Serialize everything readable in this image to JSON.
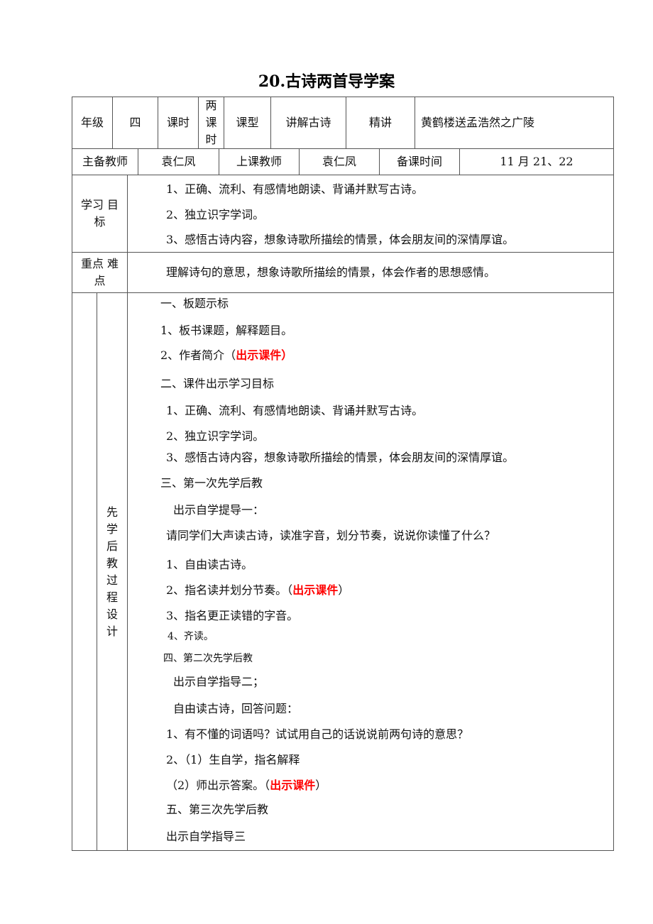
{
  "title": "20.古诗两首导学案",
  "row1": {
    "grade_label": "年级",
    "grade_value": "四",
    "period_label": "课时",
    "period_value_chars": [
      "两",
      "课",
      "时"
    ],
    "type_label": "课型",
    "type_value": "讲解古诗",
    "mode": "精讲",
    "lesson_title": "黄鹤楼送孟浩然之广陵"
  },
  "row2": {
    "main_teacher_label": "主备教师",
    "main_teacher": "袁仁凤",
    "class_teacher_label": "上课教师",
    "class_teacher": "袁仁凤",
    "prep_time_label": "备课时间",
    "prep_time": "11 月 21、22"
  },
  "goals": {
    "label_line1": "学习 目",
    "label_line2": "标",
    "items": [
      "1、正确、流利、有感情地朗读、背诵并默写古诗。",
      "2、独立识字学词。",
      "3、感悟古诗内容，想象诗歌所描绘的情景，体会朋友间的深情厚谊。"
    ]
  },
  "key_points": {
    "label_line1": "重点 难",
    "label_line2": "点",
    "text": "理解诗句的意思，想象诗歌所描绘的情景，体会作者的思想感情。"
  },
  "process": {
    "label_chars": [
      "先",
      "学",
      "后",
      "教",
      "过",
      "程",
      "设",
      "计"
    ],
    "lines": [
      {
        "text": "一、板题示标"
      },
      {
        "text": "1、板书课题，解释题目。"
      },
      {
        "text": "2、作者简介（",
        "red": "出示课件）",
        "after": ""
      },
      {
        "text": "二、课件出示学习目标"
      },
      {
        "text": "1、正确、流利、有感情地朗读、背诵并默写古诗。"
      },
      {
        "text": "2、独立识字学词。"
      },
      {
        "text": "3、感悟古诗内容，想象诗歌所描绘的情景，体会朋友间的深情厚谊。"
      },
      {
        "text": "三、第一次先学后教"
      },
      {
        "text": "出示自学提导一："
      },
      {
        "text": "请同学们大声读古诗，读准字音，划分节奏，说说你读懂了什么？"
      },
      {
        "text": "1、自由读古诗。"
      },
      {
        "text": "2、指名读并划分节奏。（",
        "red": "出示课件",
        "after": "）"
      },
      {
        "text": "3、指名更正读错的字音。"
      },
      {
        "text": "4、齐读。"
      },
      {
        "text": "四、第二次先学后教"
      },
      {
        "text": "出示自学指导二；"
      },
      {
        "text": "自由读古诗，回答问题："
      },
      {
        "text": "1、有不懂的词语吗？试试用自己的话说说前两句诗的意思？"
      },
      {
        "text": "2、（1）生自学，指名解释"
      },
      {
        "text": "（2）师出示答案。（",
        "red": "出示课件",
        "after": "）"
      },
      {
        "text": "五、第三次先学后教"
      },
      {
        "text": "出示自学指导三"
      }
    ]
  },
  "colors": {
    "highlight": "#ff0000",
    "border": "#555555"
  }
}
